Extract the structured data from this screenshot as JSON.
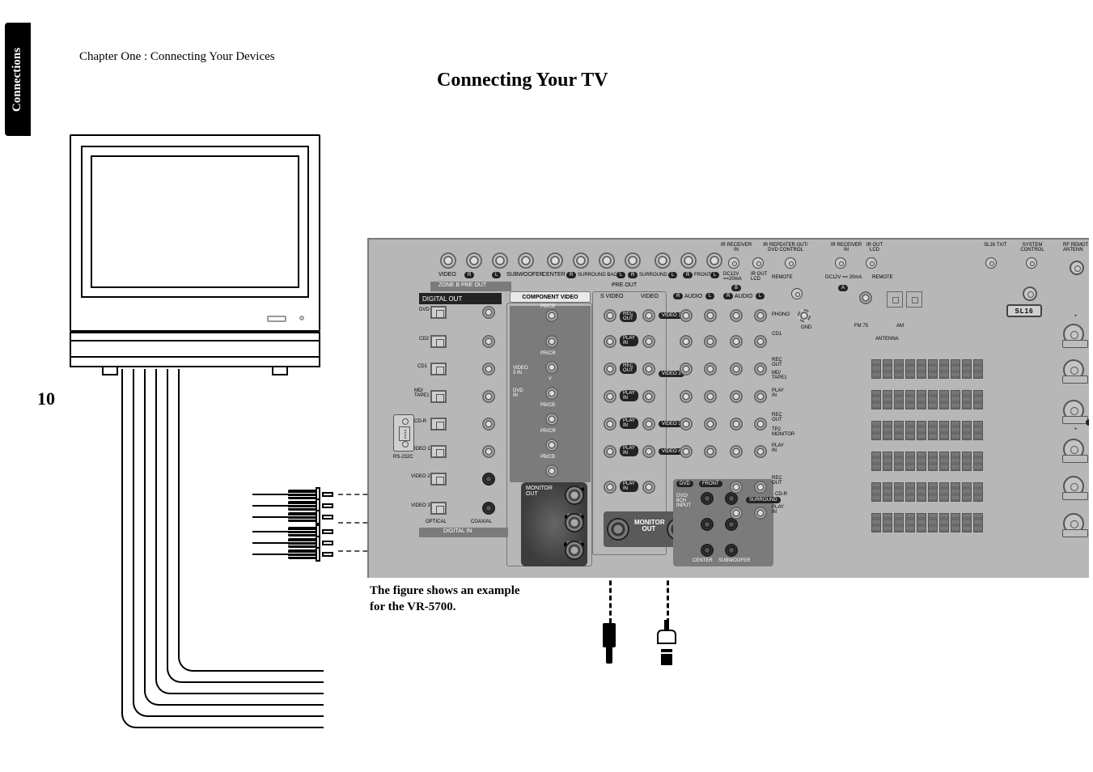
{
  "sideTab": "Connections",
  "chapterLine": "Chapter One : Connecting Your Devices",
  "title": "Connecting Your TV",
  "pageNumber": "10",
  "caption": "The figure shows an example\nfor the VR-5700.",
  "panel": {
    "zoneBPreOut": "ZONE B PRE OUT",
    "video": "VIDEO",
    "R": "R",
    "L": "L",
    "subwoofer": "SUBWOOFER",
    "center": "CENTER",
    "centerCap": "CENTER",
    "subwooferCap": "SUBWOOFER",
    "surroundBack": "SURROUND BACK",
    "surround": "SURROUND",
    "surroundCap": "SURROUND",
    "front": "FRONT",
    "preOut": "PRE OUT",
    "digitalOut": "DIGITAL OUT",
    "componentVideo": "COMPONENT VIDEO",
    "sVideo": "S VIDEO",
    "audio": "AUDIO",
    "dvd": "DVD",
    "cd1": "CD1",
    "cd2": "CD2",
    "mdTape1": "MD/\nTAPE1",
    "cdR": "CD-R",
    "video1": "VIDEO 1",
    "video2": "VIDEO 2",
    "video3": "VIDEO 3",
    "video4": "VIDEO 4",
    "optical": "OPTICAL",
    "coaxial": "COAXIAL",
    "digitalIn": "DIGITAL IN",
    "video3In": "VIDEO\n3 IN",
    "dvdIn": "DVD\nIN",
    "monitorOutLine1": "MONITOR",
    "monitorOutLine2": "OUT",
    "monitorOut": "MONITOR\nOUT",
    "y": "Y",
    "pbcb": "PB/CB",
    "prcr": "PR/CR",
    "recOut": "REC\nOUT",
    "playIn": "PLAY\nIN",
    "playInFlat": "PLAY IN",
    "in": "IN",
    "out": "OUT",
    "dvd6chInput": "DVD/\n6CH\nINPUT",
    "phono": "PHONO",
    "gnd": "GND",
    "antenna": "ANTENNA",
    "fm75": "FM 75",
    "am": "AM",
    "irReceiverIn": "IR RECEIVER\nIN",
    "irRepeaterOut": "IR REPEATER OUT/\nDVD CONTROL",
    "irOutLcd": "IR OUT\nLCD",
    "dc12v": "DC12V\n==20mA",
    "dc12v20ma": "DC12V == 20mA",
    "remote": "REMOTE",
    "a": "A",
    "sl16Txt": "SL16 TX/T",
    "sl16": "SL16",
    "systemControl": "SYSTEM\nCONTROL",
    "rfRemoteAntenna": "RF REMOT\nANTENN",
    "rs232c": "RS-232C",
    "tapeMonitor": "TP2\nMONITOR"
  }
}
